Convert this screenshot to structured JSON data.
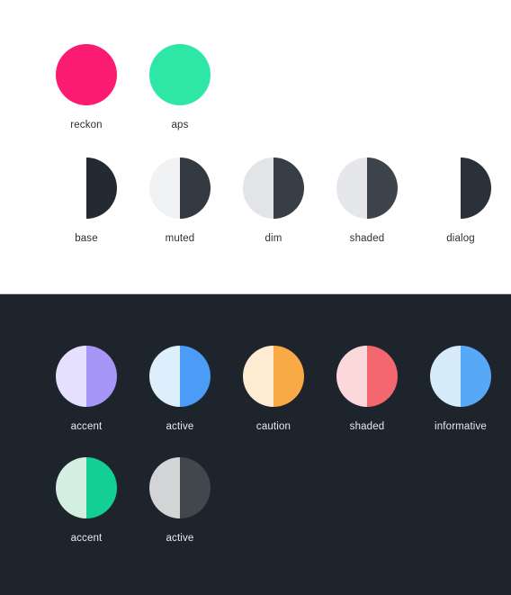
{
  "sections": [
    {
      "name": "light-theme",
      "background": "#ffffff",
      "rows": [
        {
          "name": "brand-solid",
          "swatches": [
            {
              "label": "reckon",
              "left": "#fb1b73",
              "right": "#fb1b73"
            },
            {
              "label": "aps",
              "left": "#2ee6a6",
              "right": "#2ee6a6"
            }
          ]
        },
        {
          "name": "surface-duotone",
          "swatches": [
            {
              "label": "base",
              "left": "#ffffff",
              "right": "#242a31"
            },
            {
              "label": "muted",
              "left": "#f1f2f4",
              "right": "#333940"
            },
            {
              "label": "dim",
              "left": "#e2e4e7",
              "right": "#383e45"
            },
            {
              "label": "shaded",
              "left": "#e5e7ea",
              "right": "#3e444b"
            },
            {
              "label": "dialog",
              "left": "#ffffff",
              "right": "#2b313a"
            }
          ]
        }
      ]
    },
    {
      "name": "dark-theme",
      "background": "#1e242c",
      "rows": [
        {
          "name": "status-duotone",
          "swatches": [
            {
              "label": "accent",
              "left": "#e4e0fd",
              "right": "#a596f8"
            },
            {
              "label": "active",
              "left": "#ddeefc",
              "right": "#4a9cf7"
            },
            {
              "label": "caution",
              "left": "#fdecd2",
              "right": "#f9a945"
            },
            {
              "label": "shaded",
              "left": "#fbd8da",
              "right": "#f4676e"
            },
            {
              "label": "informative",
              "left": "#d6ecfb",
              "right": "#58a8f8"
            }
          ]
        },
        {
          "name": "accent-duotone",
          "swatches": [
            {
              "label": "accent",
              "left": "#d3efe1",
              "right": "#14cf93"
            },
            {
              "label": "active",
              "left": "#d2d4d6",
              "right": "#41474d"
            }
          ]
        }
      ]
    }
  ]
}
